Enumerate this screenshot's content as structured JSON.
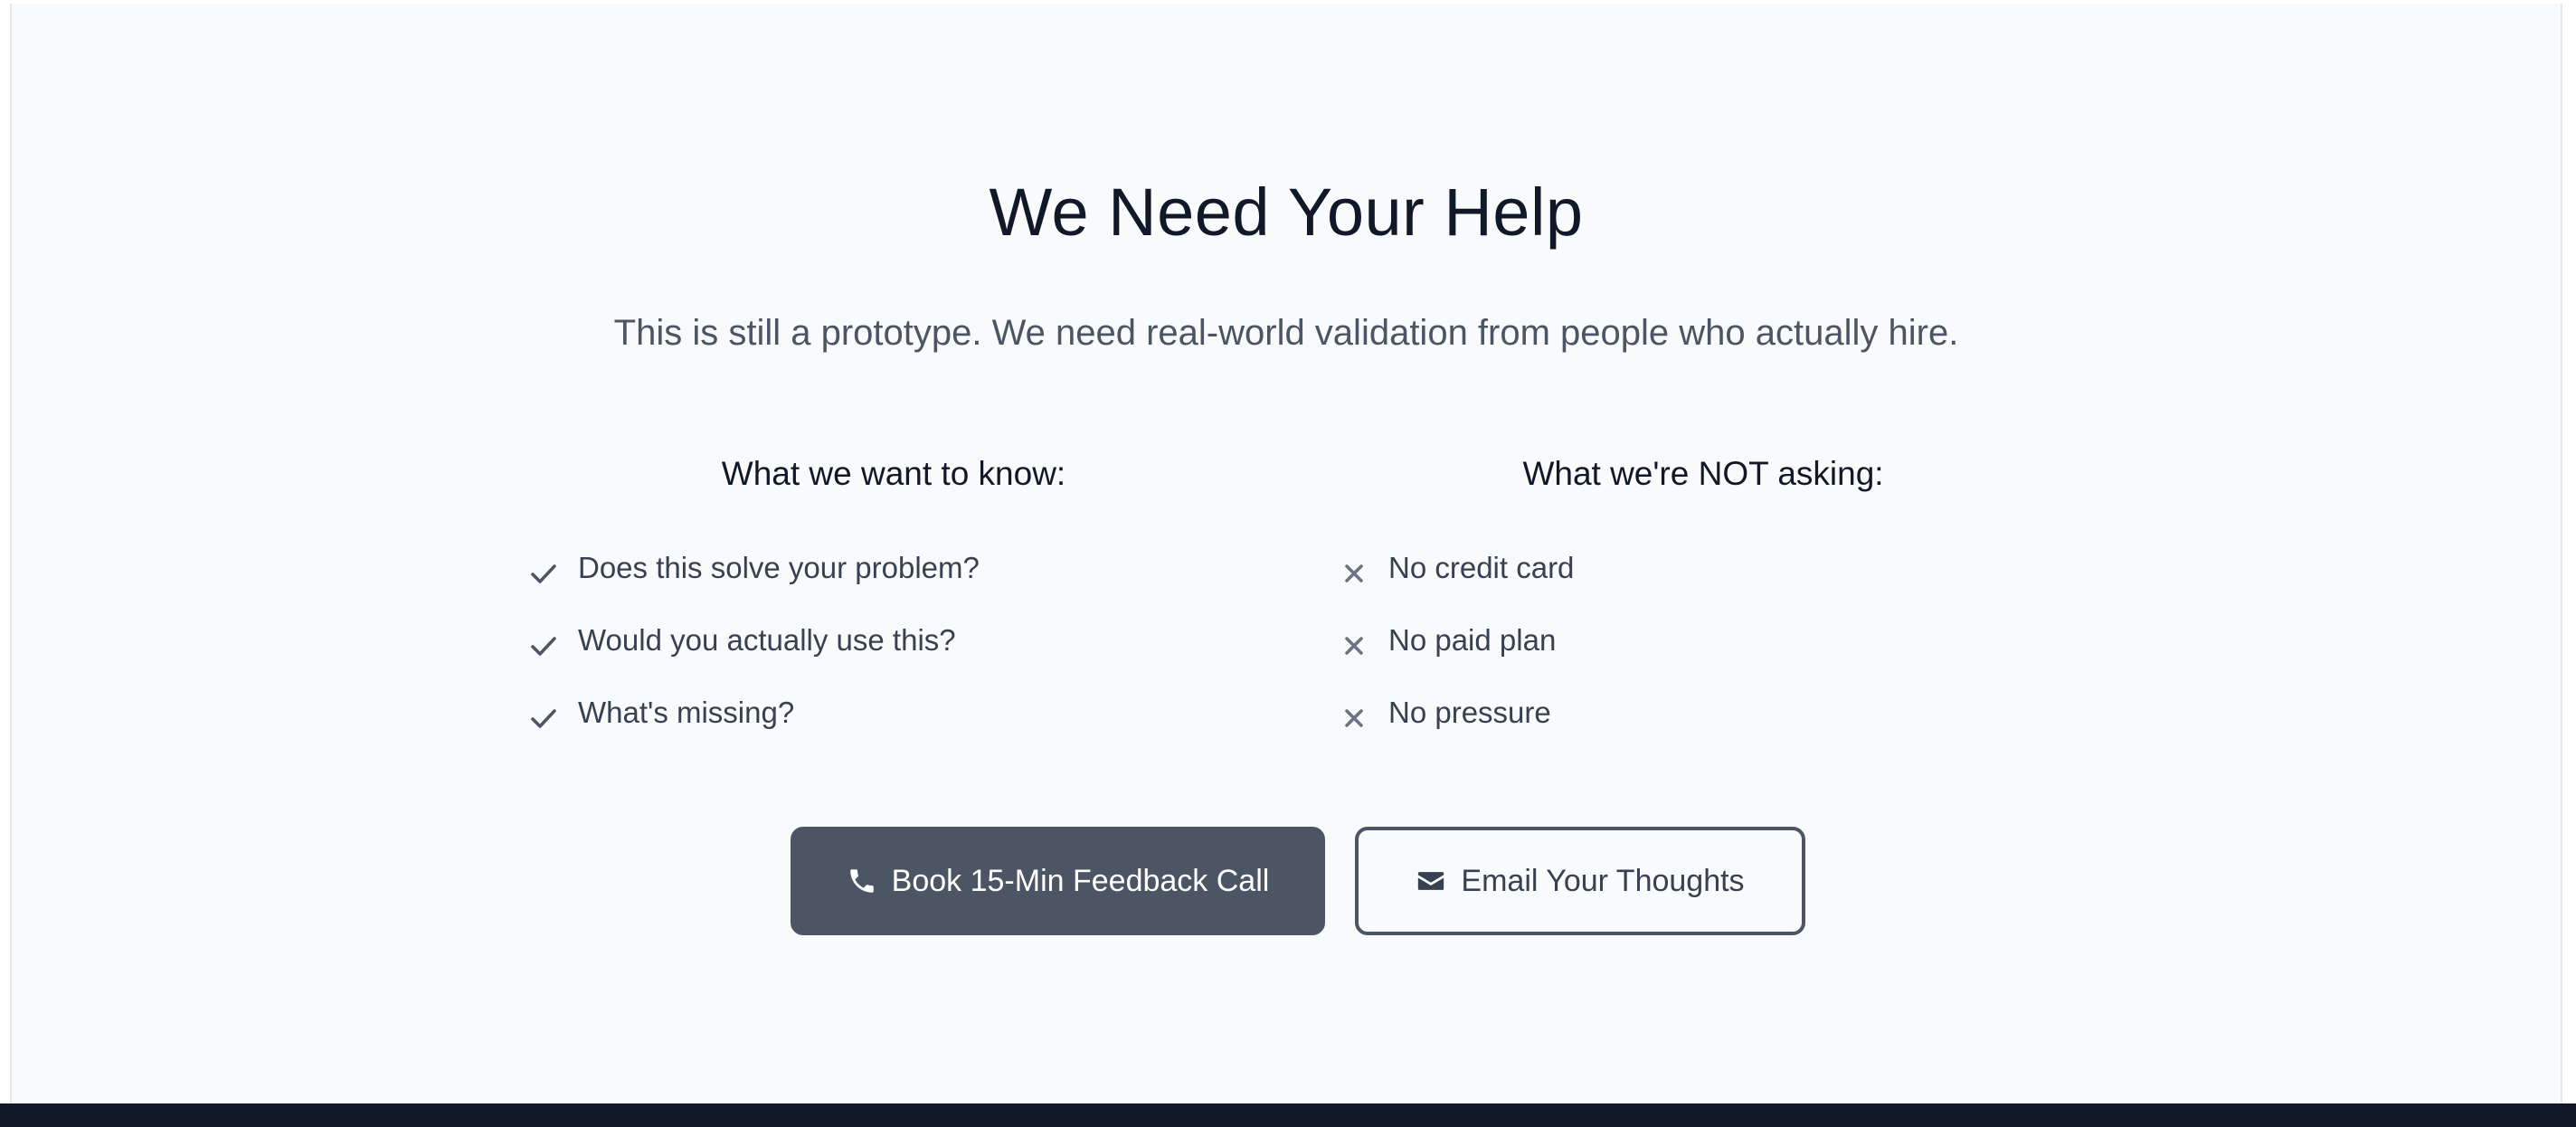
{
  "section": {
    "title": "We Need Your Help",
    "subtitle": "This is still a prototype. We need real-world validation from people who actually hire."
  },
  "want_to_know": {
    "heading": "What we want to know:",
    "icon": "check-icon",
    "items": [
      "Does this solve your problem?",
      "Would you actually use this?",
      "What's missing?"
    ]
  },
  "not_asking": {
    "heading": "What we're NOT asking:",
    "icon": "x-icon",
    "items": [
      "No credit card",
      "No paid plan",
      "No pressure"
    ]
  },
  "actions": {
    "call_label": "Book 15-Min Feedback Call",
    "call_icon": "phone-icon",
    "email_label": "Email Your Thoughts",
    "email_icon": "envelope-icon"
  },
  "colors": {
    "background": "#f8fafc",
    "heading": "#111827",
    "body_text": "#374151",
    "muted_text": "#4b5563",
    "primary_button": "#4b5563",
    "footer": "#111827"
  }
}
